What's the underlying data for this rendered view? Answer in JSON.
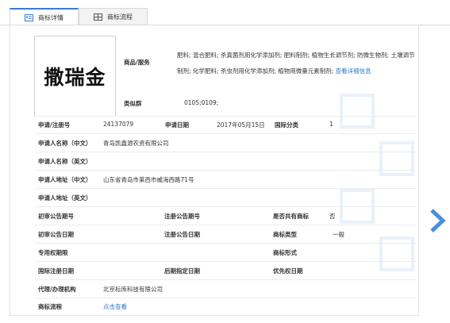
{
  "tabs": [
    {
      "label": "商标详情",
      "active": true,
      "icon": "detail-icon"
    },
    {
      "label": "商标流程",
      "active": false,
      "icon": "grid-icon"
    }
  ],
  "logo_text": "撒瑞金",
  "goods": {
    "label": "商品/服务",
    "text": "肥料; 混合肥料; 杀真菌剂用化学添加剂; 肥料制剂; 植物生长调节剂; 防微生物剂; 土壤调节制剂; 化学肥料; 杀虫剂用化学添加剂; 植物用微量元素制剂;",
    "more": "查看详细信息"
  },
  "similar_group": {
    "label": "类似群",
    "value": "0105;0109;"
  },
  "fields": {
    "reg_no_label": "申请/注册号",
    "reg_no": "24137079",
    "apply_date_label": "申请日期",
    "apply_date": "2017年05月15日",
    "intl_class_label": "国际分类",
    "intl_class": "1",
    "applicant_cn_label": "申请人名称（中文）",
    "applicant_cn": "青岛凯鑫源农资有限公司",
    "applicant_en_label": "申请人名称（英文）",
    "applicant_en": "",
    "address_cn_label": "申请人地址（中文）",
    "address_cn": "山东省青岛市莱西市威海西路71号",
    "address_en_label": "申请人地址（英文）",
    "address_en": "",
    "prelim_no_label": "初审公告期号",
    "prelim_no": "",
    "reg_pub_no_label": "注册公告期号",
    "reg_pub_no": "",
    "shared_label": "是否共有商标",
    "shared": "否",
    "prelim_date_label": "初审公告日期",
    "prelim_date": "",
    "reg_pub_date_label": "注册公告日期",
    "reg_pub_date": "",
    "tm_type_label": "商标类型",
    "tm_type": "一般",
    "exclusive_label": "专用权期限",
    "exclusive": "",
    "tm_form_label": "商标形式",
    "tm_form": "",
    "intl_reg_date_label": "国际注册日期",
    "intl_reg_date": "",
    "late_date_label": "后期指定日期",
    "late_date": "",
    "priority_date_label": "优先权日期",
    "priority_date": "",
    "agent_label": "代理/办理机构",
    "agent": "北京标库科技有限公司",
    "flow_label": "商标流程",
    "flow_link": "点击查看"
  },
  "colors": {
    "accent": "#3a7bd5",
    "link": "#2b78c5",
    "arrow": "#4a90d9"
  }
}
